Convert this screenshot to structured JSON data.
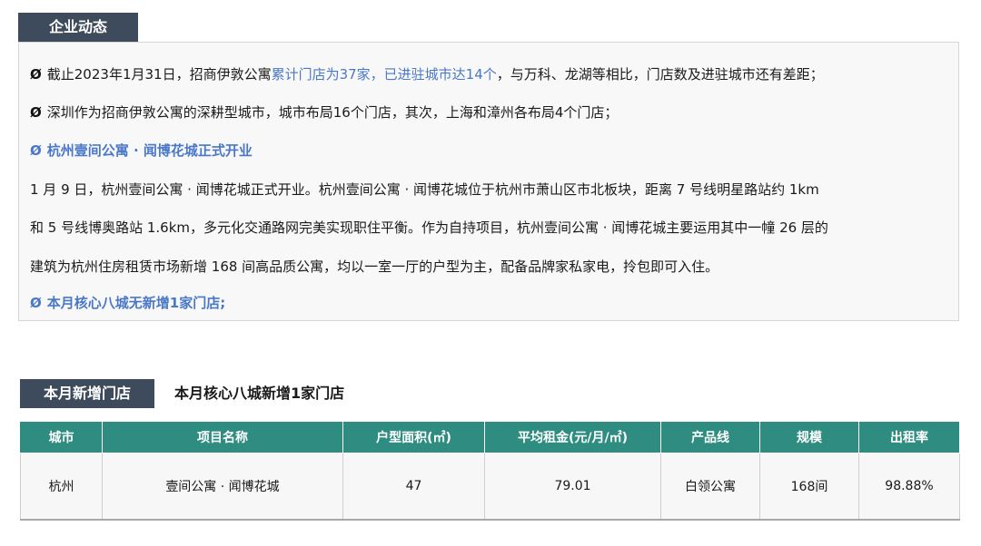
{
  "news": {
    "tag": "企业动态",
    "bullet_symbol": "Ø",
    "line1_pre": "截止2023年1月31日，招商伊敦公寓",
    "line1_highlight": "累计门店为37家，已进驻城市达14个",
    "line1_post": "，与万科、龙湖等相比，门店数及进驻城市还有差距；",
    "line2": "深圳作为招商伊敦公寓的深耕型城市，城市布局16个门店，其次，上海和漳州各布局4个门店；",
    "headline": "杭州壹间公寓 · 闻博花城正式开业",
    "para1": "1 月 9 日，杭州壹间公寓 · 闻博花城正式开业。杭州壹间公寓 · 闻博花城位于杭州市萧山区市北板块，距离 7 号线明星路站约 1km",
    "para2": "和 5 号线博奥路站 1.6km，多元化交通路网完美实现职住平衡。作为自持项目，杭州壹间公寓 · 闻博花城主要运用其中一幢 26 层的",
    "para3": "建筑为杭州住房租赁市场新增 168 间高品质公寓，均以一室一厅的户型为主，配备品牌家私家电，拎包即可入住。",
    "final": "本月核心八城无新增1家门店;"
  },
  "new_stores": {
    "tag": "本月新增门店",
    "subtitle": "本月核心八城新增1家门店",
    "headers": [
      "城市",
      "项目名称",
      "户型面积(㎡)",
      "平均租金(元/月/㎡)",
      "产品线",
      "规模",
      "出租率"
    ],
    "row": [
      "杭州",
      "壹间公寓 · 闻博花城",
      "47",
      "79.01",
      "白领公寓",
      "168间",
      "98.88%"
    ]
  },
  "colors": {
    "tag_bg": "#3d4b5c",
    "highlight": "#4a78c8",
    "table_header": "#2e8c80"
  }
}
